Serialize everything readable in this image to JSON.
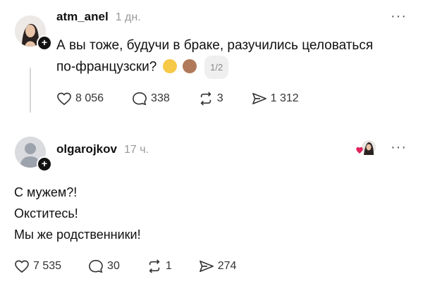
{
  "post": {
    "username": "atm_anel",
    "time": "1 дн.",
    "more": "···",
    "text_line1": "А вы тоже, будучи в браке, разучились целоваться",
    "text_line2": "по-французски?",
    "pager": "1/2",
    "emoji": [
      "laughing-with-tears-icon",
      "see-no-evil-monkey-icon"
    ],
    "stats": {
      "likes": "8 056",
      "comments": "338",
      "reposts": "3",
      "shares": "1 312"
    }
  },
  "reply": {
    "username": "olgarojkov",
    "time": "17 ч.",
    "more": "···",
    "lines": [
      "С мужем?!",
      "Окститесь!",
      "Мы же родственники!"
    ],
    "stats": {
      "likes": "7 535",
      "comments": "30",
      "reposts": "1",
      "shares": "274"
    }
  },
  "colors": {
    "text": "#111111",
    "muted": "#999999",
    "like_heart": "#e0245e"
  }
}
